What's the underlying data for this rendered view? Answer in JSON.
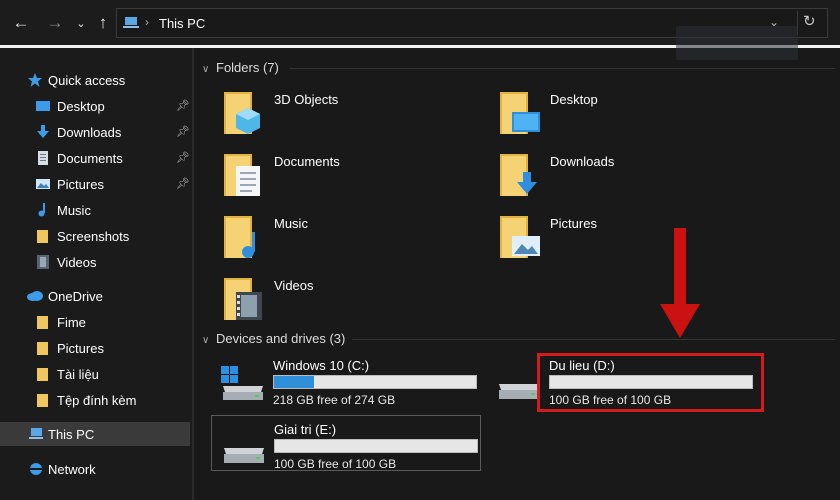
{
  "address_bar": {
    "location": "This PC"
  },
  "sidebar": {
    "items": [
      {
        "label": "Quick access",
        "icon": "star-icon",
        "pinned": false
      },
      {
        "label": "Desktop",
        "icon": "desktop-icon",
        "pinned": true
      },
      {
        "label": "Downloads",
        "icon": "download-icon",
        "pinned": true
      },
      {
        "label": "Documents",
        "icon": "documents-icon",
        "pinned": true
      },
      {
        "label": "Pictures",
        "icon": "pictures-icon",
        "pinned": true
      },
      {
        "label": "Music",
        "icon": "music-icon",
        "pinned": false
      },
      {
        "label": "Screenshots",
        "icon": "folder-icon",
        "pinned": false
      },
      {
        "label": "Videos",
        "icon": "videos-icon",
        "pinned": false
      },
      {
        "label": "OneDrive",
        "icon": "cloud-icon",
        "pinned": false
      },
      {
        "label": "Fime",
        "icon": "folder-icon",
        "pinned": false
      },
      {
        "label": "Pictures",
        "icon": "folder-icon",
        "pinned": false
      },
      {
        "label": "Tài liệu",
        "icon": "folder-icon",
        "pinned": false
      },
      {
        "label": "Tệp đính kèm",
        "icon": "folder-icon",
        "pinned": false
      },
      {
        "label": "This PC",
        "icon": "computer-icon",
        "pinned": false,
        "selected": true
      },
      {
        "label": "Network",
        "icon": "network-icon",
        "pinned": false
      }
    ]
  },
  "folders_section": {
    "header": "Folders (7)",
    "items": [
      "3D Objects",
      "Desktop",
      "Documents",
      "Downloads",
      "Music",
      "Pictures",
      "Videos"
    ]
  },
  "drives_section": {
    "header": "Devices and drives (3)",
    "drives": [
      {
        "name": "Windows 10 (C:)",
        "free_text": "218 GB free of 274 GB",
        "used_fraction": 0.2
      },
      {
        "name": "Du lieu (D:)",
        "free_text": "100 GB free of 100 GB",
        "used_fraction": 0.0
      },
      {
        "name": "Giai tri (E:)",
        "free_text": "100 GB free of 100 GB",
        "used_fraction": 0.0
      }
    ]
  },
  "colors": {
    "accent": "#2f8fd8",
    "highlight": "#d41c1c",
    "arrow": "#cc1111",
    "background": "#191919"
  }
}
